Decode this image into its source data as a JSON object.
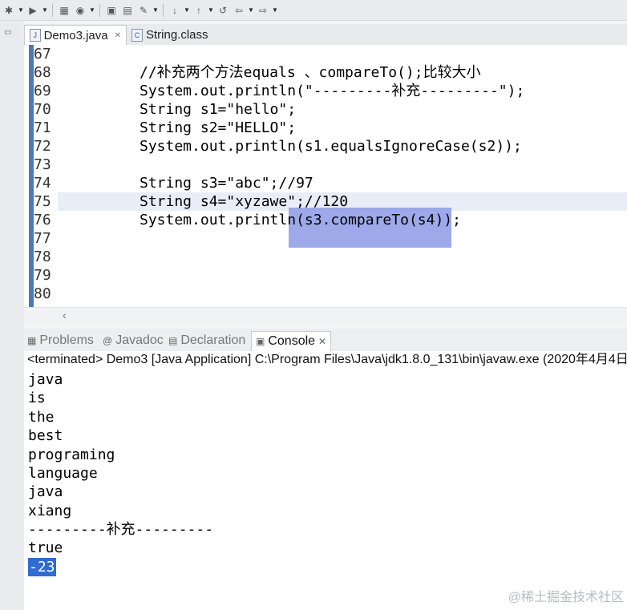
{
  "toolbar": {
    "icons": [
      "debug-icon",
      "run-icon",
      "new-java-project-icon",
      "open-type-icon",
      "search-icon",
      "next-annotation-icon",
      "previous-annotation-icon",
      "back-icon",
      "forward-icon"
    ]
  },
  "editor": {
    "tabs": [
      {
        "label": "Demo3.java",
        "active": true
      },
      {
        "label": "String.class",
        "active": false
      }
    ],
    "lines": [
      {
        "num": "67",
        "code": ""
      },
      {
        "num": "68",
        "code": "//补充两个方法equals 、compareTo();比较大小"
      },
      {
        "num": "69",
        "code": "System.out.println(\"---------补充---------\");"
      },
      {
        "num": "70",
        "code": "String s1=\"hello\";"
      },
      {
        "num": "71",
        "code": "String s2=\"HELLO\";"
      },
      {
        "num": "72",
        "code": "System.out.println(s1.equalsIgnoreCase(s2));"
      },
      {
        "num": "73",
        "code": ""
      },
      {
        "num": "74",
        "code": "String s3=\"abc\";//97"
      },
      {
        "num": "75",
        "code": "String s4=\"xyzawe\";//120"
      },
      {
        "num": "76",
        "code": "System.out.println(s3.compareTo(s4));"
      },
      {
        "num": "77",
        "code": ""
      },
      {
        "num": "78",
        "code": ""
      },
      {
        "num": "79",
        "code": ""
      },
      {
        "num": "80",
        "code": ""
      }
    ]
  },
  "bottom_panel": {
    "tabs": [
      {
        "label": "Problems",
        "active": false
      },
      {
        "label": "Javadoc",
        "active": false
      },
      {
        "label": "Declaration",
        "active": false
      },
      {
        "label": "Console",
        "active": true
      }
    ],
    "console_header": "<terminated> Demo3 [Java Application] C:\\Program Files\\Java\\jdk1.8.0_131\\bin\\javaw.exe (2020年4月4日",
    "output": [
      "java",
      "is",
      "the",
      "best",
      "programing",
      "language",
      "java",
      "xiang",
      "---------补充---------",
      "true",
      "-23"
    ]
  },
  "watermark": "@稀土掘金技术社区",
  "colors": {
    "line_bar": "#4b79b8",
    "selection": "#8d9ae6",
    "output_selection": "#2f6bd0"
  }
}
